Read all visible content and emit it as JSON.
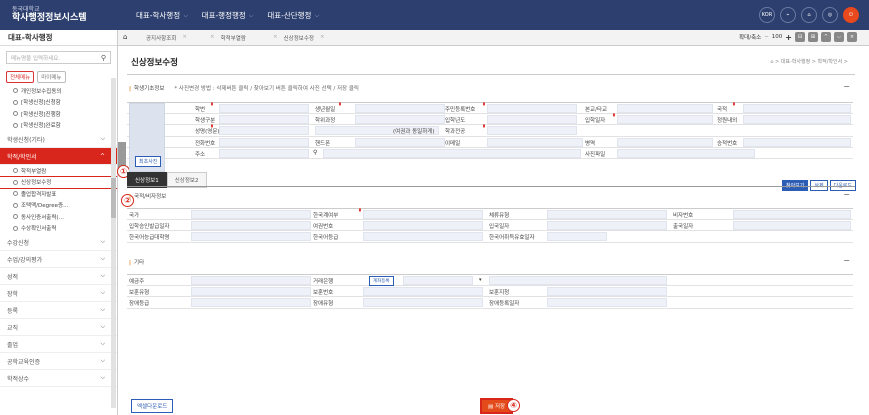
{
  "header": {
    "univ": "동국대학교",
    "system": "학사행정정보시스템",
    "menus": [
      "대표-학사행정",
      "대표-행정행정",
      "대표-산단행정"
    ],
    "icons": [
      "KOR",
      "⌁",
      "⌂",
      "◎",
      "⏻"
    ]
  },
  "sidebar": {
    "title": "대표-학사행정",
    "search_placeholder": "메뉴명을 입력하세요.",
    "btn_all": "전체메뉴",
    "btn_my": "마이메뉴",
    "top_items": [
      "개인정보수집동의",
      "[학생신청]신청함",
      "[학생신청]진행함",
      "[학생신청]완료함"
    ],
    "group1": "학생신청(기타)",
    "active_group": "학적/학인서",
    "sub_items": [
      "학적부열람",
      "신상정보수정",
      "졸업합격자발표",
      "조택맥/Degree증...",
      "동사인증서출력(...",
      "수상확인서출력"
    ],
    "groups": [
      "수강신청",
      "수업/강의평가",
      "성적",
      "장학",
      "등록",
      "교직",
      "졸업",
      "공학교육인증",
      "학적상수"
    ]
  },
  "tabs": {
    "items": [
      "공지사항조회",
      "학적부열람",
      "신상정보수정"
    ],
    "zoom_label": "확대/축소",
    "zoom_value": "100"
  },
  "main": {
    "title": "신상정보수정",
    "crumb": "⌂ > 대표-학사행정 > 학적/학인서 >",
    "sec1": "학생기초정보",
    "sec1_note": "* 사진변경 방법 : 삭제버튼 클릭 / 찾아보기 버튼 클릭하여 사진 선택 / 저장 클릭",
    "r1": [
      "학번",
      "생년월일",
      "주민등록번호",
      "본교/타교",
      "국적"
    ],
    "r2": [
      "학생구분",
      "학위과정",
      "입학년도",
      "입학일자",
      "정원내외"
    ],
    "r3": [
      "성명(영문)",
      "(여권과 동일하게)",
      "학과전공"
    ],
    "r4": [
      "전화번호",
      "핸드폰",
      "이메일",
      "병역",
      "승적번호"
    ],
    "r5": [
      "주소",
      "사진파일"
    ],
    "photo_btn": "최초사진",
    "btn_browse": "찾아보기",
    "btn_delete": "삭제",
    "btn_download": "다운로드",
    "subtab1": "신상정보1",
    "subtab2": "신상정보2",
    "sec2": "국적/비자정보",
    "v1": [
      "국가",
      "한국계여부",
      "체류유형",
      "비자번호"
    ],
    "v2": [
      "입학승인발급일자",
      "여권번호",
      "입국일자",
      "출국일자"
    ],
    "v3": [
      "한국어능급대학명",
      "한국어등급",
      "한국어취득유효일자"
    ],
    "sec3": "기타",
    "e1": [
      "예금주",
      "거래은행",
      "계좌등록"
    ],
    "e2": [
      "보훈유형",
      "보훈번호",
      "보훈지청"
    ],
    "e3": [
      "장애등급",
      "장애유형",
      "장애등록일자"
    ],
    "btn_excel": "엑셀다운로드",
    "btn_save": "저장"
  },
  "annotations": [
    "①",
    "②",
    "④"
  ]
}
